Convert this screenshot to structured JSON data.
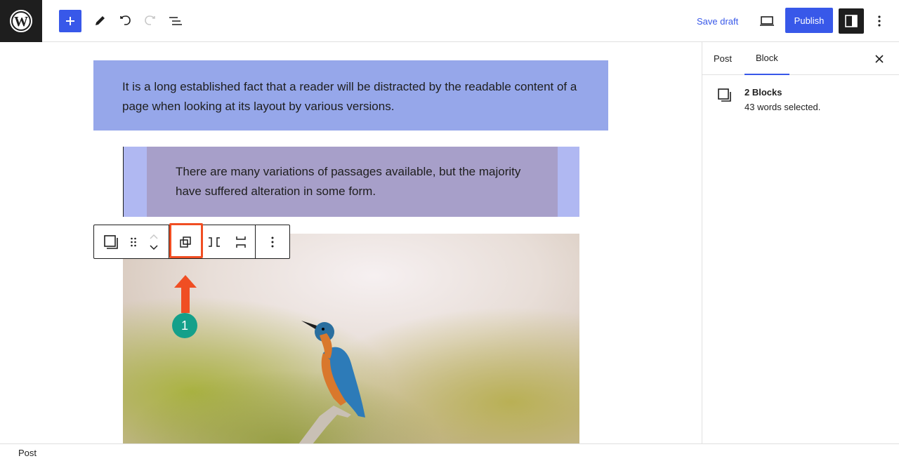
{
  "topbar": {
    "save_draft_label": "Save draft",
    "publish_label": "Publish"
  },
  "sidebar": {
    "tabs": [
      {
        "label": "Post"
      },
      {
        "label": "Block"
      }
    ],
    "active_tab": "Block",
    "selection_title": "2 Blocks",
    "selection_desc": "43 words selected."
  },
  "content": {
    "paragraph1": "It is a long established fact that a reader will be distracted by the readable content of a page when looking at its layout by various versions.",
    "paragraph2": "There are many variations of passages available, but the majority have suffered alteration in some form."
  },
  "annotation": {
    "badge": "1"
  },
  "footer": {
    "breadcrumb": "Post"
  },
  "colors": {
    "accent": "#3858e9",
    "highlight": "#f04e23",
    "badge": "#15a08a",
    "para1_bg": "#96a7ea",
    "group_bg": "#b0b8f2",
    "quote_bg": "#a79fc9"
  }
}
